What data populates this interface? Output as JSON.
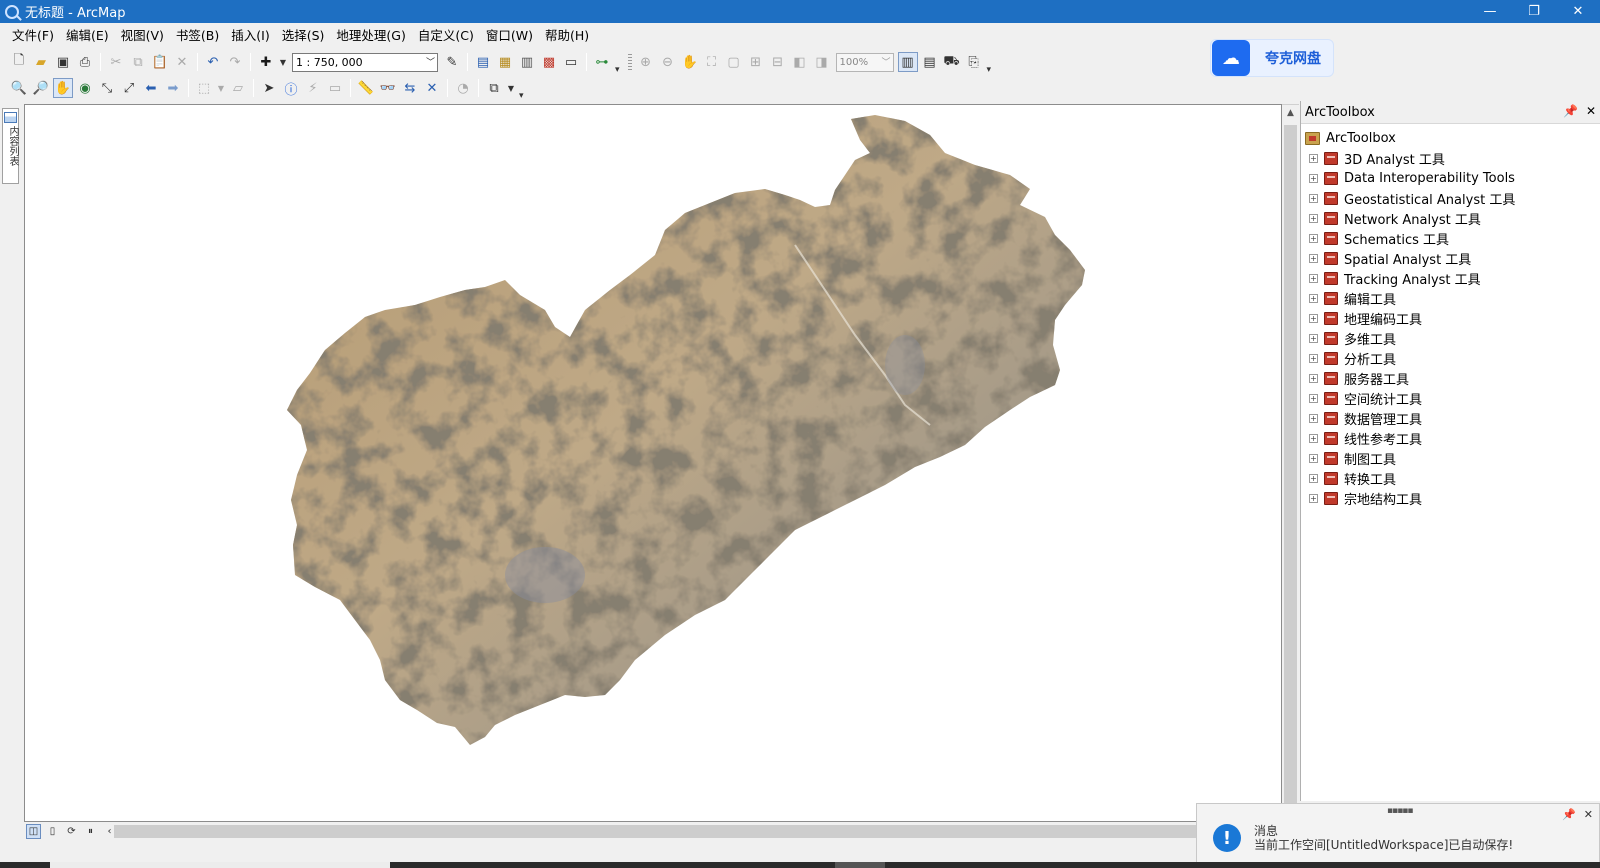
{
  "window": {
    "title": "无标题 - ArcMap",
    "controls": [
      "—",
      "❐",
      "✕"
    ]
  },
  "menu": [
    "文件(F)",
    "编辑(E)",
    "视图(V)",
    "书签(B)",
    "插入(I)",
    "选择(S)",
    "地理处理(G)",
    "自定义(C)",
    "窗口(W)",
    "帮助(H)"
  ],
  "toolbar": {
    "scale": "1 : 750, 000",
    "layout_zoom": "100%"
  },
  "quark": {
    "label": "夸克网盘"
  },
  "left_dock": {
    "tab_label": "内容列表"
  },
  "toolbox": {
    "title": "ArcToolbox",
    "root": "ArcToolbox",
    "items": [
      "3D Analyst 工具",
      "Data Interoperability Tools",
      "Geostatistical Analyst 工具",
      "Network Analyst 工具",
      "Schematics 工具",
      "Spatial Analyst 工具",
      "Tracking Analyst 工具",
      "编辑工具",
      "地理编码工具",
      "多维工具",
      "分析工具",
      "服务器工具",
      "空间统计工具",
      "数据管理工具",
      "线性参考工具",
      "制图工具",
      "转换工具",
      "宗地结构工具"
    ]
  },
  "notification": {
    "title": "消息",
    "message": "当前工作空间[UntitledWorkspace]已自动保存!"
  },
  "colors": {
    "titlebar": "#1e6fc2",
    "map_land": "#b9a07c",
    "map_dark": "#3d3528"
  }
}
